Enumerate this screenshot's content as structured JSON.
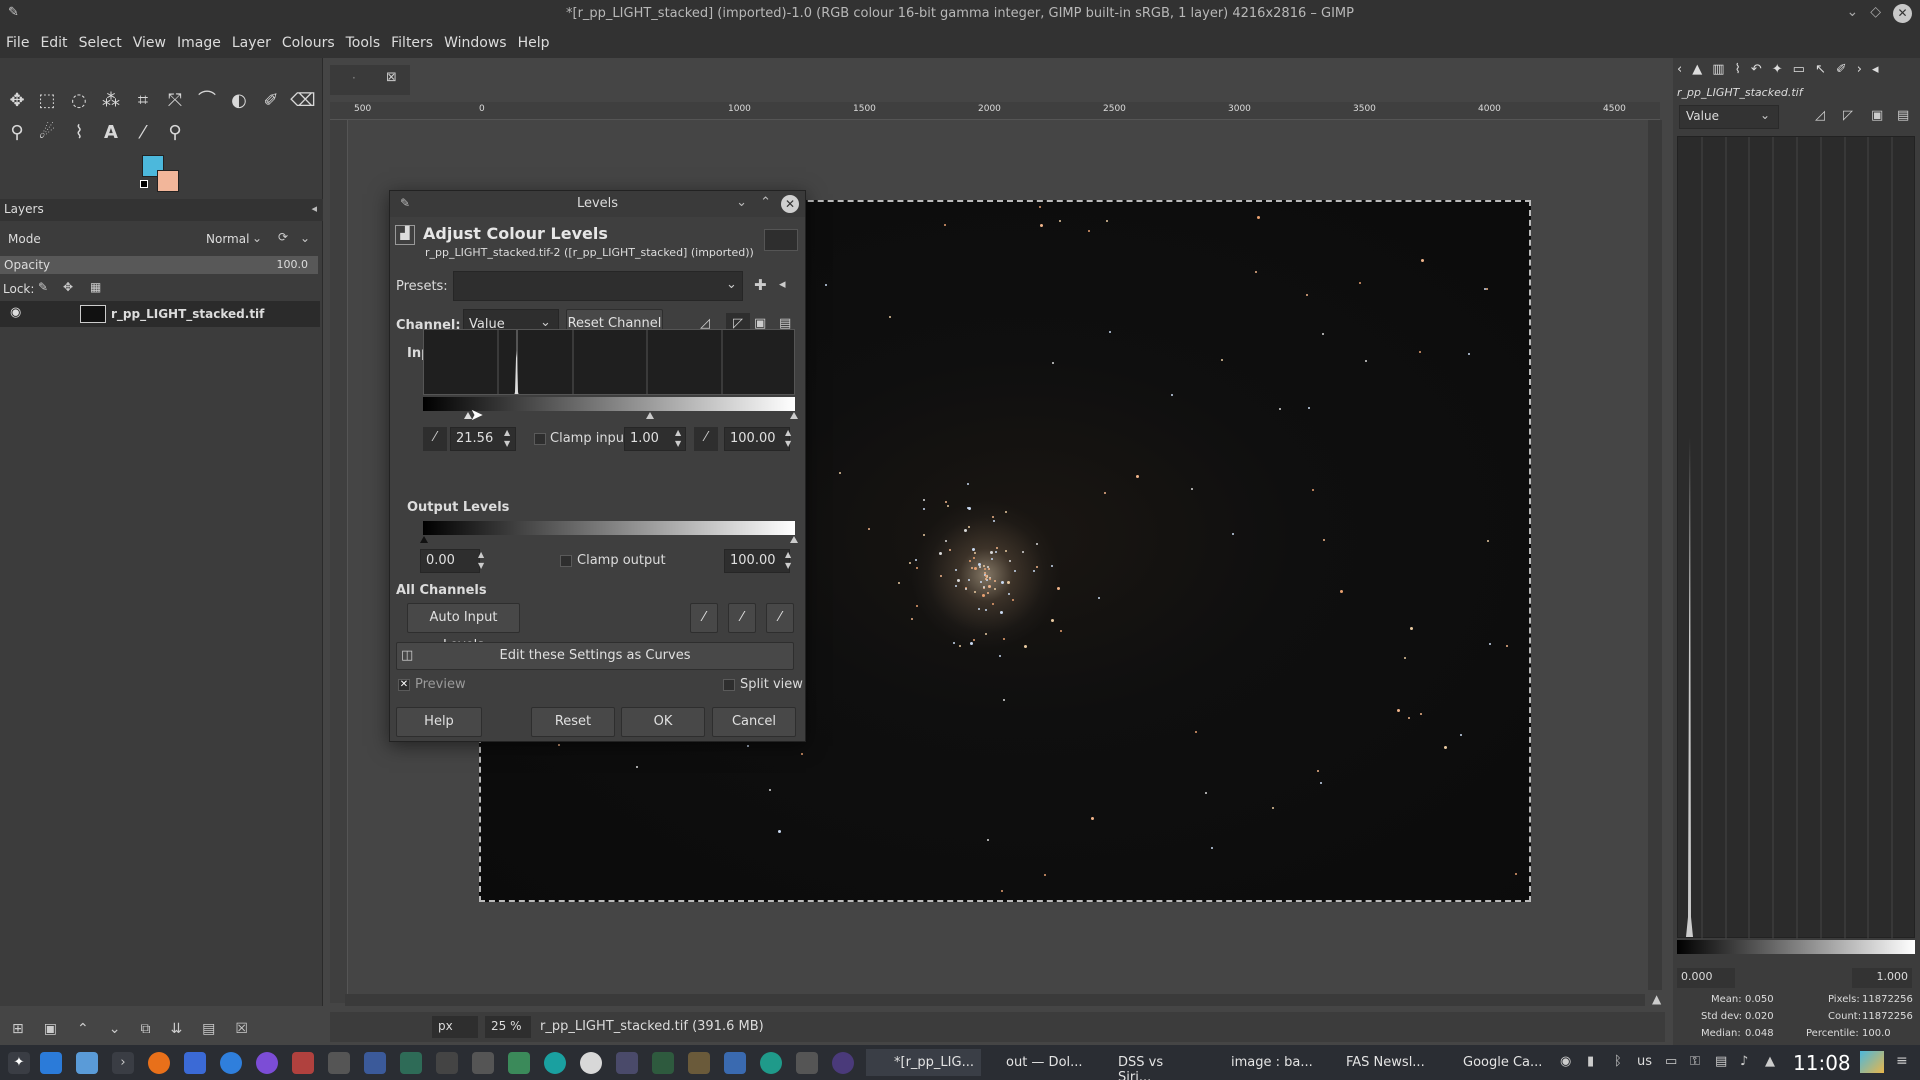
{
  "window": {
    "title": "*[r_pp_LIGHT_stacked] (imported)-1.0 (RGB colour 16-bit gamma integer, GIMP built-in sRGB, 1 layer) 4216x2816 – GIMP"
  },
  "menu": [
    "File",
    "Edit",
    "Select",
    "View",
    "Image",
    "Layer",
    "Colours",
    "Tools",
    "Filters",
    "Windows",
    "Help"
  ],
  "layers": {
    "tab": "Layers",
    "mode_label": "Mode",
    "mode_value": "Normal",
    "opacity_label": "Opacity",
    "opacity_value": "100.0",
    "lock_label": "Lock:",
    "layer_name": "r_pp_LIGHT_stacked.tif"
  },
  "ruler": {
    "marks": [
      "500",
      "0",
      "1000",
      "1500",
      "2000",
      "2500",
      "3000",
      "3500",
      "4000",
      "4500"
    ]
  },
  "status": {
    "unit": "px",
    "zoom": "25 %",
    "file_info": "r_pp_LIGHT_stacked.tif (391.6 MB)"
  },
  "levels": {
    "title": "Levels",
    "heading": "Adjust Colour Levels",
    "subheading": "r_pp_LIGHT_stacked.tif-2 ([r_pp_LIGHT_stacked] (imported))",
    "presets_label": "Presets:",
    "channel_label": "Channel:",
    "channel_value": "Value",
    "reset_channel": "Reset Channel",
    "input_levels": "Input Levels",
    "input_low": "21.56",
    "clamp_input": "Clamp input",
    "gamma": "1.00",
    "input_high": "100.00",
    "output_levels": "Output Levels",
    "output_low": "0.00",
    "clamp_output": "Clamp output",
    "output_high": "100.00",
    "all_channels": "All Channels",
    "auto_input": "Auto Input Levels",
    "edit_curves": "Edit these Settings as Curves",
    "preview": "Preview",
    "split_view": "Split view",
    "help": "Help",
    "reset": "Reset",
    "ok": "OK",
    "cancel": "Cancel"
  },
  "histogram": {
    "file": "r_pp_LIGHT_stacked.tif",
    "channel": "Value",
    "low": "0.000",
    "high": "1.000",
    "mean_label": "Mean:",
    "mean": "0.050",
    "std_label": "Std dev:",
    "std": "0.020",
    "median_label": "Median:",
    "median": "0.048",
    "pixels_label": "Pixels:",
    "pixels": "11872256",
    "count_label": "Count:",
    "count": "11872256",
    "percentile_label": "Percentile:",
    "percentile": "100.0"
  },
  "taskbar": {
    "tasks": [
      "*[r_pp_LIG...",
      "out — Dol...",
      "DSS vs Siri...",
      "image : ba...",
      "FAS Newsl...",
      "Google Ca..."
    ],
    "keyboard": "us",
    "clock": "11:08"
  },
  "colors": {
    "fg": "#4cb8dc",
    "bg": "#f2b69a",
    "accent": "#ffffff"
  }
}
